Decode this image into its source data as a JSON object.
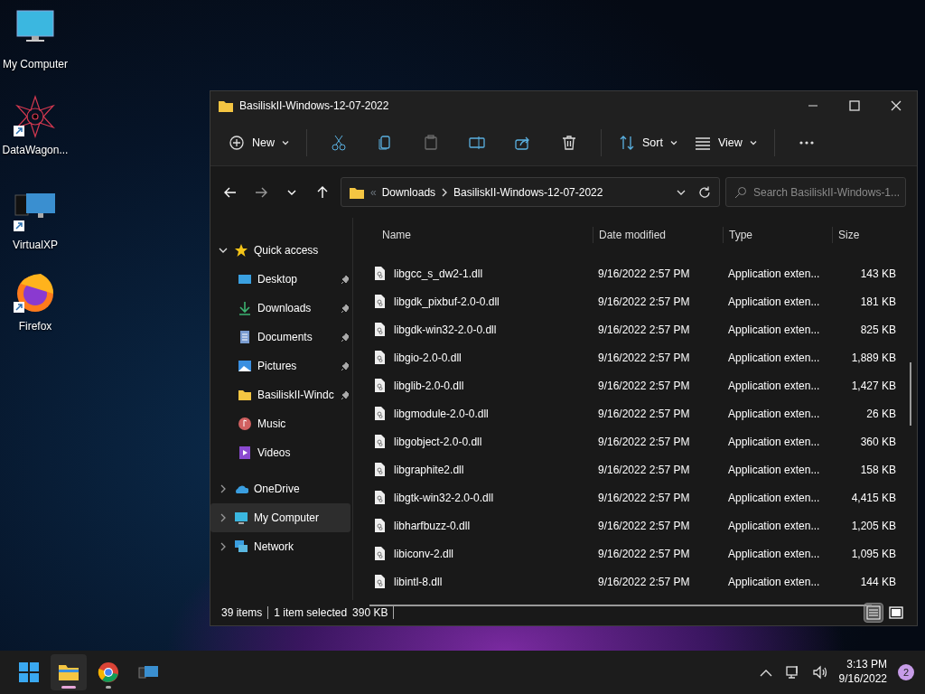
{
  "desktop_icons": [
    {
      "kind": "computer",
      "label": "My Computer",
      "shortcut": false
    },
    {
      "kind": "star",
      "label": "DataWagon...",
      "shortcut": true
    },
    {
      "kind": "vm",
      "label": "VirtualXP",
      "shortcut": true
    },
    {
      "kind": "firefox",
      "label": "Firefox",
      "shortcut": true
    }
  ],
  "window": {
    "title": "BasiliskII-Windows-12-07-2022"
  },
  "toolbar": [
    {
      "kind": "new",
      "label": "New",
      "disabled": false
    },
    {
      "kind": "cut",
      "disabled": false
    },
    {
      "kind": "copy",
      "disabled": false
    },
    {
      "kind": "paste",
      "disabled": true
    },
    {
      "kind": "rename",
      "disabled": false
    },
    {
      "kind": "share",
      "disabled": false
    },
    {
      "kind": "delete",
      "disabled": false
    },
    {
      "kind": "sort",
      "label": "Sort",
      "disabled": false
    },
    {
      "kind": "view",
      "label": "View",
      "disabled": false
    },
    {
      "kind": "more",
      "disabled": false
    }
  ],
  "address": {
    "overflow": "«",
    "path": [
      "Downloads",
      "BasiliskII-Windows-12-07-2022"
    ]
  },
  "search": {
    "placeholder": "Search BasiliskII-Windows-1..."
  },
  "sidebar": {
    "items": [
      {
        "kind": "quick",
        "label": "Quick access",
        "expanded": true,
        "selected": false,
        "children": [
          {
            "kind": "desktop",
            "label": "Desktop",
            "pinned": true,
            "selected": false
          },
          {
            "kind": "downloads",
            "label": "Downloads",
            "pinned": true,
            "selected": false
          },
          {
            "kind": "documents",
            "label": "Documents",
            "pinned": true,
            "selected": false
          },
          {
            "kind": "pictures",
            "label": "Pictures",
            "pinned": true,
            "selected": false
          },
          {
            "kind": "folder",
            "label": "BasiliskII-Windc",
            "pinned": true,
            "selected": false
          },
          {
            "kind": "music",
            "label": "Music",
            "pinned": false,
            "selected": false
          },
          {
            "kind": "videos",
            "label": "Videos",
            "pinned": false,
            "selected": false
          }
        ]
      },
      {
        "kind": "onedrive",
        "label": "OneDrive",
        "expanded": false,
        "selected": false
      },
      {
        "kind": "computer",
        "label": "My Computer",
        "expanded": false,
        "selected": true
      },
      {
        "kind": "network",
        "label": "Network",
        "expanded": false,
        "selected": false
      }
    ]
  },
  "table": {
    "columns": [
      "Name",
      "Date modified",
      "Type",
      "Size"
    ],
    "rows": [
      {
        "name": "libgcc_s_dw2-1.dll",
        "date": "9/16/2022 2:57 PM",
        "type": "Application exten...",
        "size": "143 KB",
        "selected": false
      },
      {
        "name": "libgdk_pixbuf-2.0-0.dll",
        "date": "9/16/2022 2:57 PM",
        "type": "Application exten...",
        "size": "181 KB",
        "selected": false
      },
      {
        "name": "libgdk-win32-2.0-0.dll",
        "date": "9/16/2022 2:57 PM",
        "type": "Application exten...",
        "size": "825 KB",
        "selected": false
      },
      {
        "name": "libgio-2.0-0.dll",
        "date": "9/16/2022 2:57 PM",
        "type": "Application exten...",
        "size": "1,889 KB",
        "selected": false
      },
      {
        "name": "libglib-2.0-0.dll",
        "date": "9/16/2022 2:57 PM",
        "type": "Application exten...",
        "size": "1,427 KB",
        "selected": false
      },
      {
        "name": "libgmodule-2.0-0.dll",
        "date": "9/16/2022 2:57 PM",
        "type": "Application exten...",
        "size": "26 KB",
        "selected": false
      },
      {
        "name": "libgobject-2.0-0.dll",
        "date": "9/16/2022 2:57 PM",
        "type": "Application exten...",
        "size": "360 KB",
        "selected": false
      },
      {
        "name": "libgraphite2.dll",
        "date": "9/16/2022 2:57 PM",
        "type": "Application exten...",
        "size": "158 KB",
        "selected": false
      },
      {
        "name": "libgtk-win32-2.0-0.dll",
        "date": "9/16/2022 2:57 PM",
        "type": "Application exten...",
        "size": "4,415 KB",
        "selected": false
      },
      {
        "name": "libharfbuzz-0.dll",
        "date": "9/16/2022 2:57 PM",
        "type": "Application exten...",
        "size": "1,205 KB",
        "selected": false
      },
      {
        "name": "libiconv-2.dll",
        "date": "9/16/2022 2:57 PM",
        "type": "Application exten...",
        "size": "1,095 KB",
        "selected": false
      },
      {
        "name": "libintl-8.dll",
        "date": "9/16/2022 2:57 PM",
        "type": "Application exten...",
        "size": "144 KB",
        "selected": false
      }
    ]
  },
  "status_bar": {
    "count": "39 items",
    "selection": "1 item selected",
    "selection_size": "390 KB",
    "view_buttons": [
      {
        "kind": "details",
        "selected": true
      },
      {
        "kind": "preview",
        "selected": false
      }
    ]
  },
  "taskbar": {
    "apps": [
      {
        "kind": "start",
        "active": false,
        "running": false
      },
      {
        "kind": "explorer",
        "active": true,
        "running": true
      },
      {
        "kind": "chrome",
        "active": false,
        "running": true
      },
      {
        "kind": "vm",
        "active": false,
        "running": false
      }
    ],
    "time": "3:13 PM",
    "date": "9/16/2022",
    "notifications": "2"
  }
}
